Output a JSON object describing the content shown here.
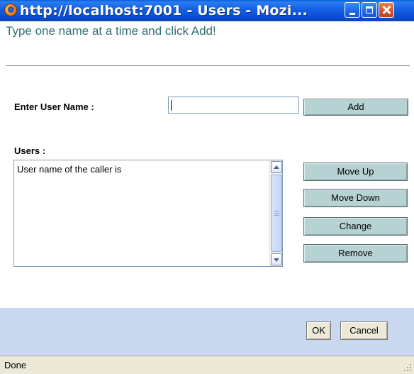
{
  "window": {
    "title": "http://localhost:7001 - Users - Mozi..."
  },
  "icons": {
    "app_icon": "firefox-icon",
    "minimize": "minimize-icon",
    "maximize": "maximize-icon",
    "close": "close-icon",
    "scroll_up": "arrow-up-icon",
    "scroll_down": "arrow-down-icon"
  },
  "colors": {
    "button_face": "#b7d2d3",
    "footer_background": "#c9d8ee",
    "instruction_text": "#2f6f74"
  },
  "form": {
    "instruction": "Type one name at a time and click Add!",
    "user_name_label": "Enter User Name :",
    "user_name_value": "",
    "add_button": "Add",
    "users_label": "Users :",
    "users_list": [
      "User name of the caller is"
    ],
    "move_up_button": "Move Up",
    "move_down_button": "Move Down",
    "change_button": "Change",
    "remove_button": "Remove"
  },
  "footer": {
    "ok_button": "OK",
    "cancel_button": "Cancel"
  },
  "status": {
    "text": "Done"
  }
}
